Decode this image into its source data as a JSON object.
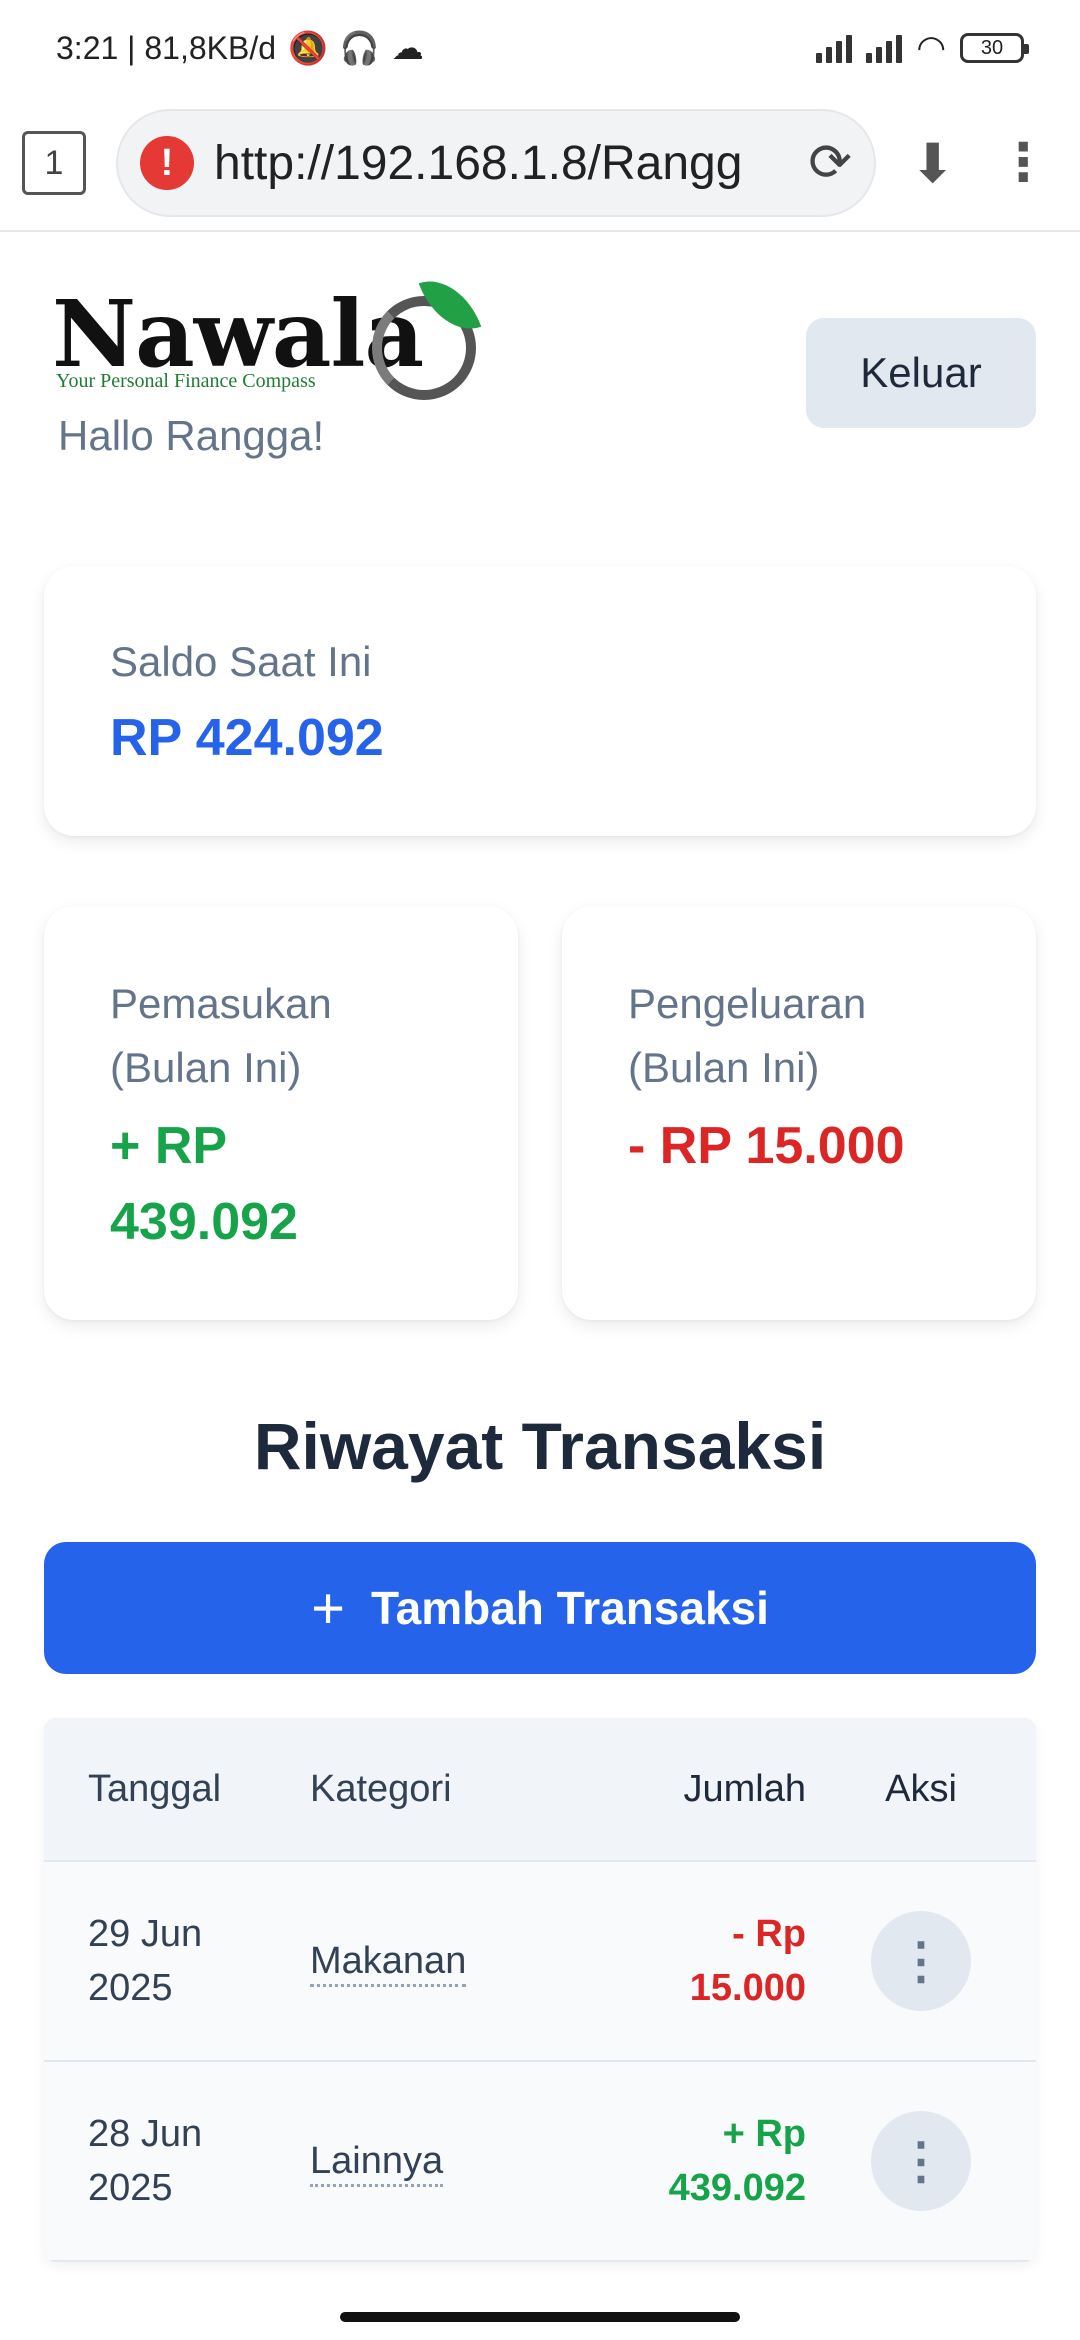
{
  "status_bar": {
    "time_speed": "3:21 | 81,8KB/d",
    "battery": "30"
  },
  "browser": {
    "tab_count": "1",
    "url": "http://192.168.1.8/Rangg"
  },
  "header": {
    "logo_word": "Nawala",
    "logo_tagline": "Your Personal Finance Compass",
    "greeting": "Hallo Rangga!",
    "logout_label": "Keluar"
  },
  "balance": {
    "label": "Saldo Saat Ini",
    "value": "RP 424.092"
  },
  "income": {
    "label_line1": "Pemasukan",
    "label_line2": "(Bulan Ini)",
    "value_line1": "+ RP",
    "value_line2": "439.092"
  },
  "expense": {
    "label_line1": "Pengeluaran",
    "label_line2": "(Bulan Ini)",
    "value": "- RP 15.000"
  },
  "transactions": {
    "title": "Riwayat Transaksi",
    "add_label": "Tambah Transaksi",
    "columns": [
      "Tanggal",
      "Kategori",
      "Jumlah",
      "Aksi"
    ],
    "rows": [
      {
        "date_line1": "29 Jun",
        "date_line2": "2025",
        "category": "Makanan",
        "amount_line1": "- Rp",
        "amount_line2": "15.000"
      },
      {
        "date_line1": "28 Jun",
        "date_line2": "2025",
        "category": "Lainnya",
        "amount_line1": "+ Rp",
        "amount_line2": "439.092"
      }
    ]
  },
  "colors": {
    "primary": "#2563eb",
    "income": "#16a34a",
    "expense": "#dc2626",
    "muted": "#64748b"
  },
  "icons": {
    "warning": "warning-triangle-icon",
    "reload": "reload-icon",
    "download": "download-icon",
    "menu": "more-vertical-icon",
    "add": "plus-icon",
    "row_action": "kebab-menu-icon"
  }
}
